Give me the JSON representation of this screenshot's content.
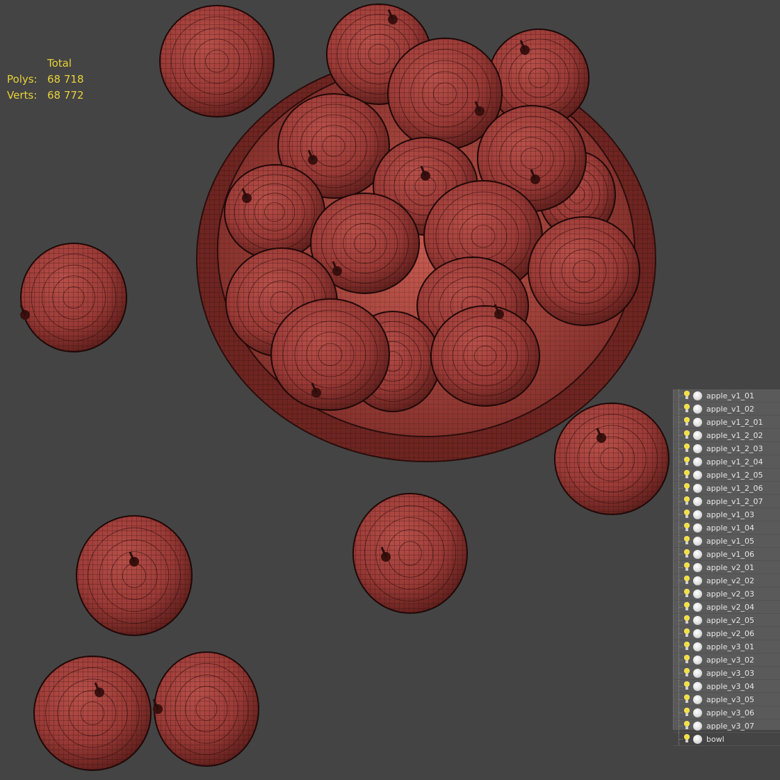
{
  "stats": {
    "header": "Total",
    "polys_label": "Polys:",
    "polys_value": "68 718",
    "verts_label": "Verts:",
    "verts_value": "68 772"
  },
  "scene": {
    "background_color": "#444444",
    "mesh_color": "#9a3a36",
    "wire_color": "#2a0d0c",
    "objects": [
      "bowl",
      "apple"
    ]
  },
  "layers": {
    "items": [
      {
        "name": "apple_v1_01",
        "icons": [
          "bulb-icon",
          "render-icon"
        ]
      },
      {
        "name": "apple_v1_02",
        "icons": [
          "bulb-icon",
          "render-icon"
        ]
      },
      {
        "name": "apple_v1_2_01",
        "icons": [
          "bulb-icon",
          "render-icon"
        ]
      },
      {
        "name": "apple_v1_2_02",
        "icons": [
          "bulb-icon",
          "render-icon"
        ]
      },
      {
        "name": "apple_v1_2_03",
        "icons": [
          "bulb-icon",
          "render-icon"
        ]
      },
      {
        "name": "apple_v1_2_04",
        "icons": [
          "bulb-icon",
          "render-icon"
        ]
      },
      {
        "name": "apple_v1_2_05",
        "icons": [
          "bulb-icon",
          "render-icon"
        ]
      },
      {
        "name": "apple_v1_2_06",
        "icons": [
          "bulb-icon",
          "render-icon"
        ]
      },
      {
        "name": "apple_v1_2_07",
        "icons": [
          "bulb-icon",
          "render-icon"
        ]
      },
      {
        "name": "apple_v1_03",
        "icons": [
          "bulb-icon",
          "render-icon"
        ]
      },
      {
        "name": "apple_v1_04",
        "icons": [
          "bulb-icon",
          "render-icon"
        ]
      },
      {
        "name": "apple_v1_05",
        "icons": [
          "bulb-icon",
          "render-icon"
        ]
      },
      {
        "name": "apple_v1_06",
        "icons": [
          "bulb-icon",
          "render-icon"
        ]
      },
      {
        "name": "apple_v2_01",
        "icons": [
          "bulb-icon",
          "render-icon"
        ]
      },
      {
        "name": "apple_v2_02",
        "icons": [
          "bulb-icon",
          "render-icon"
        ]
      },
      {
        "name": "apple_v2_03",
        "icons": [
          "bulb-icon",
          "render-icon"
        ]
      },
      {
        "name": "apple_v2_04",
        "icons": [
          "bulb-icon",
          "render-icon"
        ]
      },
      {
        "name": "apple_v2_05",
        "icons": [
          "bulb-icon",
          "render-icon"
        ]
      },
      {
        "name": "apple_v2_06",
        "icons": [
          "bulb-icon",
          "render-icon"
        ]
      },
      {
        "name": "apple_v3_01",
        "icons": [
          "bulb-icon",
          "render-icon"
        ]
      },
      {
        "name": "apple_v3_02",
        "icons": [
          "bulb-icon",
          "render-icon"
        ]
      },
      {
        "name": "apple_v3_03",
        "icons": [
          "bulb-icon",
          "render-icon"
        ]
      },
      {
        "name": "apple_v3_04",
        "icons": [
          "bulb-icon",
          "render-icon"
        ]
      },
      {
        "name": "apple_v3_05",
        "icons": [
          "bulb-icon",
          "render-icon"
        ]
      },
      {
        "name": "apple_v3_06",
        "icons": [
          "bulb-icon",
          "render-icon"
        ]
      },
      {
        "name": "apple_v3_07",
        "icons": [
          "bulb-icon",
          "render-icon"
        ]
      },
      {
        "name": "bowl",
        "icons": [
          "bulb-icon",
          "render-icon"
        ]
      }
    ]
  }
}
